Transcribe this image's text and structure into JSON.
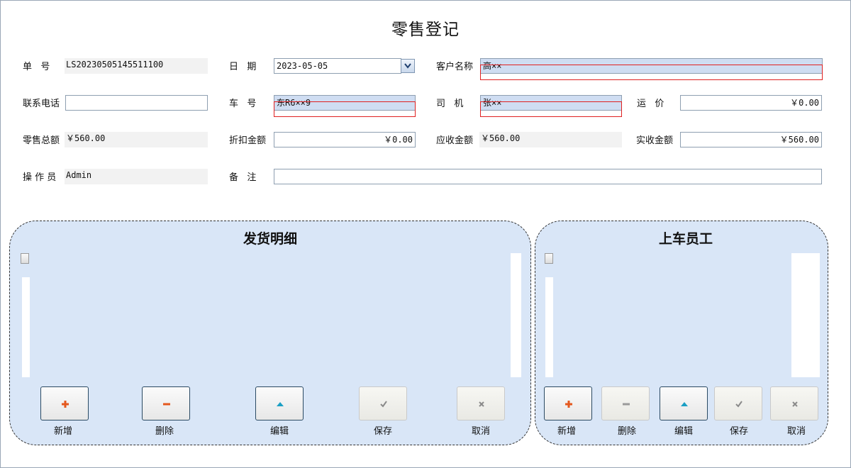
{
  "title": "零售登记",
  "fields": {
    "order_no": {
      "label": "单   号",
      "value": "LS20230505145511100"
    },
    "date": {
      "label": "日   期",
      "value": "2023-05-05"
    },
    "customer": {
      "label": "客户名称",
      "value": "高××"
    },
    "phone": {
      "label": "联系电话",
      "value": ""
    },
    "plate": {
      "label": "车   号",
      "value": "东R6××9"
    },
    "driver": {
      "label": "司   机",
      "value": "张××"
    },
    "freight": {
      "label": "运   价",
      "value": "￥0.00"
    },
    "retail_total": {
      "label": "零售总额",
      "value": "￥560.00"
    },
    "discount": {
      "label": "折扣金额",
      "value": "￥0.00"
    },
    "receivable": {
      "label": "应收金额",
      "value": "￥560.00"
    },
    "received": {
      "label": "实收金额",
      "value": "￥560.00"
    },
    "operator": {
      "label": "操 作 员",
      "value": "Admin"
    },
    "remark": {
      "label": "备   注",
      "value": ""
    }
  },
  "panels": {
    "delivery": {
      "title": "发货明细",
      "buttons": [
        {
          "label": "新增",
          "icon": "plus-icon",
          "enabled": true
        },
        {
          "label": "删除",
          "icon": "minus-icon",
          "enabled": true
        },
        {
          "label": "编辑",
          "icon": "edit-icon",
          "enabled": true
        },
        {
          "label": "保存",
          "icon": "check-icon",
          "enabled": false
        },
        {
          "label": "取消",
          "icon": "close-icon",
          "enabled": false
        }
      ]
    },
    "staff": {
      "title": "上车员工",
      "buttons": [
        {
          "label": "新增",
          "icon": "plus-icon",
          "enabled": true
        },
        {
          "label": "删除",
          "icon": "minus-icon",
          "enabled": false
        },
        {
          "label": "编辑",
          "icon": "edit-icon",
          "enabled": true
        },
        {
          "label": "保存",
          "icon": "check-icon",
          "enabled": false
        },
        {
          "label": "取消",
          "icon": "close-icon",
          "enabled": false
        }
      ]
    }
  },
  "colors": {
    "panel_bg": "#d9e6f7",
    "field_highlight": "#cfddf2",
    "redaction": "#e02020",
    "plus": "#e4581e",
    "edit": "#1b9fc4"
  }
}
